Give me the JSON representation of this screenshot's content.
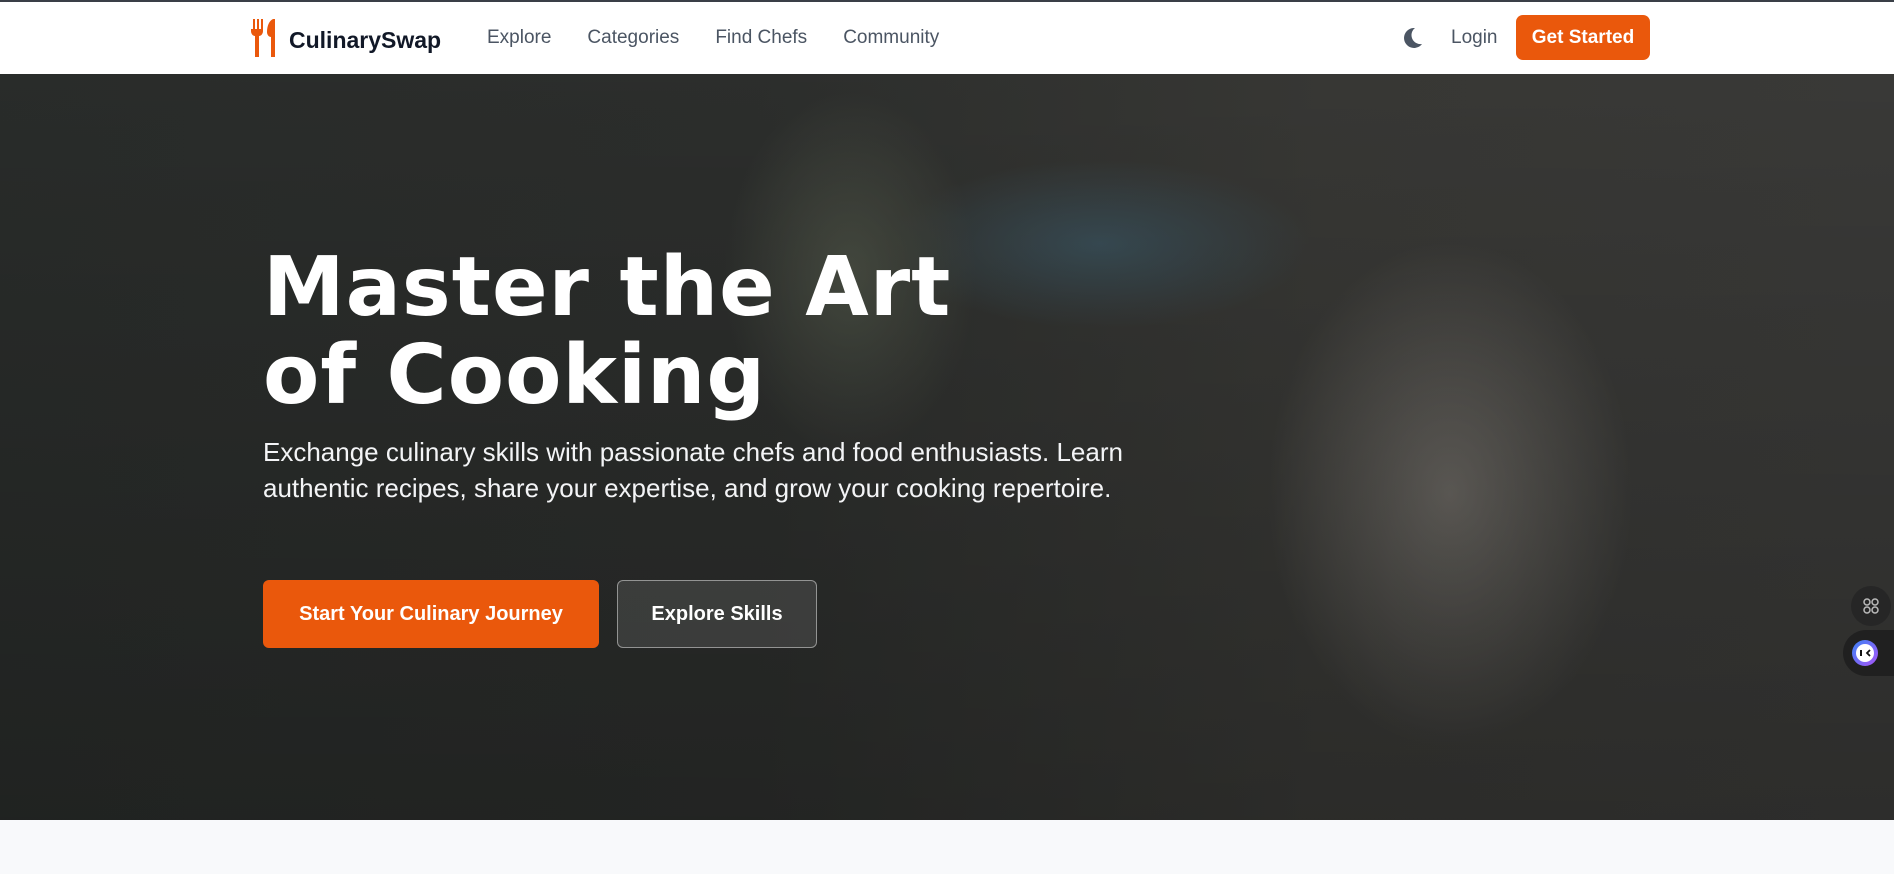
{
  "brand": {
    "name": "CulinarySwap",
    "accent": "#ea580c"
  },
  "nav": {
    "items": [
      "Explore",
      "Categories",
      "Find Chefs",
      "Community"
    ],
    "login": "Login",
    "get_started": "Get Started",
    "theme_icon": "moon-icon"
  },
  "hero": {
    "title": "Master the Art of Cooking",
    "subtitle": "Exchange culinary skills with passionate chefs and food enthusiasts. Learn authentic recipes, share your expertise, and grow your cooking repertoire.",
    "primary_button": "Start Your Culinary Journey",
    "secondary_button": "Explore Skills"
  },
  "floating": {
    "apps_icon": "grid-icon",
    "assistant_icon": "assistant-avatar-icon"
  }
}
